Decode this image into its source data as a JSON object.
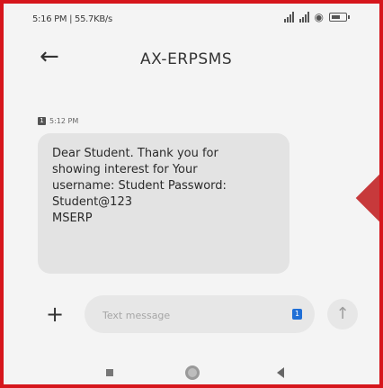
{
  "status_bar": {
    "time": "5:16 PM | 55.7KB/s"
  },
  "header": {
    "title": "AX-ERPSMS"
  },
  "message": {
    "sim": "1",
    "time": "5:12 PM",
    "text": "Dear Student. Thank you for\nshowing interest for          Your\nusername: Student   Password:\n Student@123\n MSERP"
  },
  "composer": {
    "placeholder": "Text message",
    "sim_indicator": "1"
  },
  "icons": {
    "back": "arrow-left-icon",
    "attach": "plus-icon",
    "send": "arrow-up-icon",
    "wifi": "wifi-icon",
    "battery": "battery-icon"
  },
  "colors": {
    "frame_border": "#d6161c",
    "bubble": "#e3e3e3",
    "sim_accent": "#1f6fd6"
  }
}
